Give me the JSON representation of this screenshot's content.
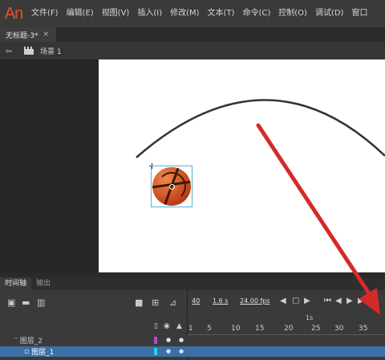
{
  "app": {
    "logo": "An"
  },
  "menu": [
    "文件(F)",
    "编辑(E)",
    "视图(V)",
    "插入(I)",
    "修改(M)",
    "文本(T)",
    "命令(C)",
    "控制(O)",
    "调试(D)",
    "窗口"
  ],
  "document_tab": {
    "title": "无标题-3*",
    "close": "×"
  },
  "scene": {
    "label": "场景 1"
  },
  "timeline_tabs": [
    "时间轴",
    "输出"
  ],
  "timeline_info": {
    "frame": "40",
    "time": "1.6 s",
    "fps": "24.00 fps"
  },
  "ruler": {
    "seconds_label": "1s",
    "numbers": [
      "1",
      "5",
      "10",
      "15",
      "20",
      "25",
      "30",
      "35"
    ]
  },
  "layers": [
    {
      "name": "图层_2",
      "color": "#b04bd4",
      "selected": false
    },
    {
      "name": "图层_1",
      "color": "#2ad3e8",
      "selected": true
    }
  ],
  "colors": {
    "arrow": "#d42a2a",
    "path": "#333333",
    "selection_row": "#3b6fa5"
  },
  "icons": {
    "toolbar": [
      "new-layer-icon",
      "new-folder-icon",
      "delete-icon"
    ],
    "right_tools": [
      "camera-icon",
      "parent-view-icon",
      "graph-icon"
    ],
    "playback": [
      "prev-keyframe-icon",
      "add-keyframe-icon",
      "next-keyframe-icon",
      "first-frame-icon",
      "step-back-icon",
      "play-icon",
      "step-forward-icon",
      "last-frame-icon"
    ]
  }
}
